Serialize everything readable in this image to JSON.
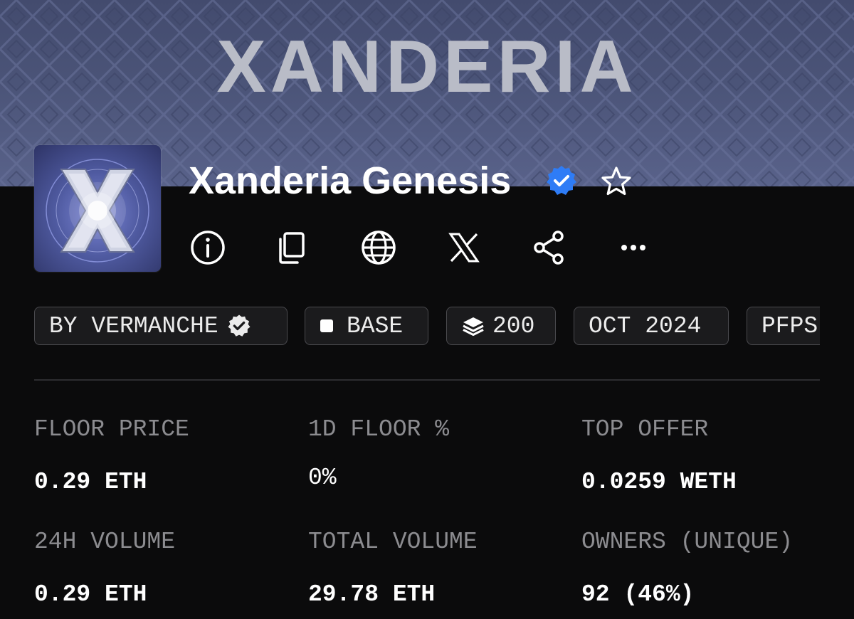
{
  "banner": {
    "title": "XANDERIA"
  },
  "collection": {
    "name": "Xanderia Genesis"
  },
  "icons": {
    "verified": "verified-badge-icon",
    "favorite": "star-icon",
    "actions": [
      "info-icon",
      "copy-icon",
      "globe-icon",
      "x-logo-icon",
      "share-icon",
      "more-icon"
    ]
  },
  "chips": {
    "creator": "BY VERMANCHE",
    "chain": "BASE",
    "items": "200",
    "date": "OCT 2024",
    "category": "PFPS"
  },
  "stats": {
    "floor_price": {
      "label": "FLOOR PRICE",
      "value": "0.29 ETH"
    },
    "floor_change": {
      "label": "1D FLOOR %",
      "value": "0%"
    },
    "top_offer": {
      "label": "TOP OFFER",
      "value": "0.0259 WETH"
    },
    "volume_24h": {
      "label": "24H VOLUME",
      "value": "0.29 ETH"
    },
    "total_volume": {
      "label": "TOTAL VOLUME",
      "value": "29.78 ETH"
    },
    "owners": {
      "label": "OWNERS (UNIQUE)",
      "value": "92 (46%)"
    }
  },
  "colors": {
    "background": "#0b0b0c",
    "banner": "#4b5478",
    "verified": "#2e7cf6",
    "label": "#8c8c90",
    "chip_border": "#4a4a4e"
  }
}
